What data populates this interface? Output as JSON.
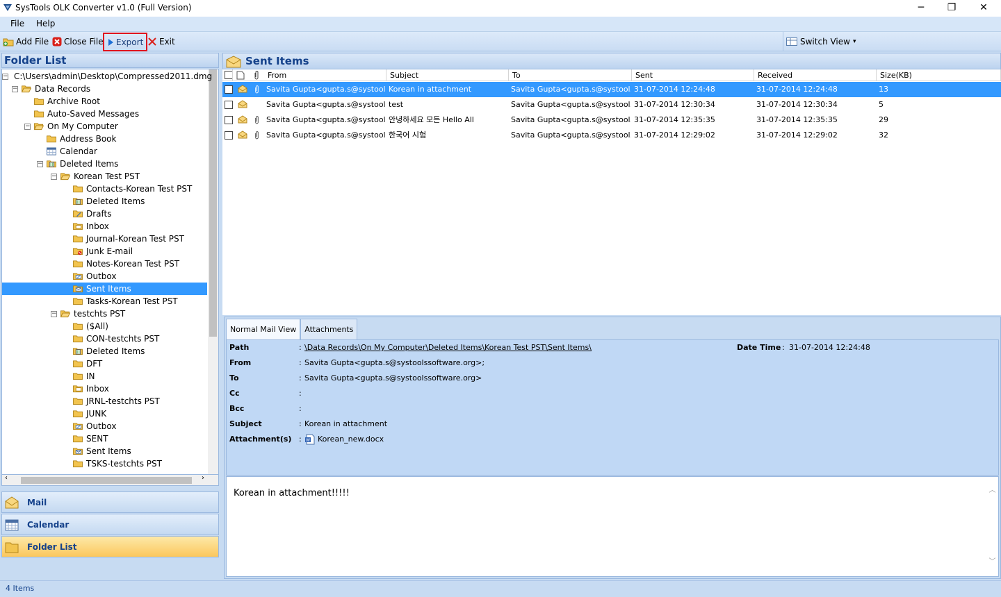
{
  "window": {
    "title": "SysTools OLK Converter v1.0 (Full Version)",
    "minimize": "─",
    "maximize": "❐",
    "close": "✕"
  },
  "menu": {
    "file": "File",
    "help": "Help"
  },
  "toolbar": {
    "add_file": "Add File",
    "close_file": "Close File",
    "export": "Export",
    "exit": "Exit",
    "switch_view": "Switch View",
    "switch_view_arrow": "▾"
  },
  "folder_panel": {
    "title": "Folder List",
    "tree": [
      {
        "label": "C:\\Users\\admin\\Desktop\\Compressed2011.dmg",
        "indent": 0,
        "expander": "−",
        "icon": "folder-open"
      },
      {
        "label": "Data Records",
        "indent": 1,
        "expander": "−",
        "icon": "folder-open"
      },
      {
        "label": "Archive Root",
        "indent": 2,
        "expander": "",
        "icon": "folder"
      },
      {
        "label": "Auto-Saved Messages",
        "indent": 2,
        "expander": "",
        "icon": "folder"
      },
      {
        "label": "On My Computer",
        "indent": 2,
        "expander": "−",
        "icon": "folder-open"
      },
      {
        "label": "Address Book",
        "indent": 3,
        "expander": "",
        "icon": "folder"
      },
      {
        "label": "Calendar",
        "indent": 3,
        "expander": "",
        "icon": "calendar"
      },
      {
        "label": "Deleted Items",
        "indent": 3,
        "expander": "−",
        "icon": "deleted"
      },
      {
        "label": "Korean Test PST",
        "indent": 4,
        "expander": "−",
        "icon": "folder-open"
      },
      {
        "label": "Contacts-Korean Test PST",
        "indent": 5,
        "expander": "",
        "icon": "folder"
      },
      {
        "label": "Deleted Items",
        "indent": 5,
        "expander": "",
        "icon": "deleted"
      },
      {
        "label": "Drafts",
        "indent": 5,
        "expander": "",
        "icon": "drafts"
      },
      {
        "label": "Inbox",
        "indent": 5,
        "expander": "",
        "icon": "inbox"
      },
      {
        "label": "Journal-Korean Test PST",
        "indent": 5,
        "expander": "",
        "icon": "folder"
      },
      {
        "label": "Junk E-mail",
        "indent": 5,
        "expander": "",
        "icon": "junk"
      },
      {
        "label": "Notes-Korean Test PST",
        "indent": 5,
        "expander": "",
        "icon": "folder"
      },
      {
        "label": "Outbox",
        "indent": 5,
        "expander": "",
        "icon": "outbox"
      },
      {
        "label": "Sent Items",
        "indent": 5,
        "expander": "",
        "icon": "sent",
        "selected": true
      },
      {
        "label": "Tasks-Korean Test PST",
        "indent": 5,
        "expander": "",
        "icon": "folder"
      },
      {
        "label": "testchts PST",
        "indent": 4,
        "expander": "−",
        "icon": "folder-open"
      },
      {
        "label": "($All)",
        "indent": 5,
        "expander": "",
        "icon": "folder"
      },
      {
        "label": "CON-testchts PST",
        "indent": 5,
        "expander": "",
        "icon": "folder"
      },
      {
        "label": "Deleted Items",
        "indent": 5,
        "expander": "",
        "icon": "deleted"
      },
      {
        "label": "DFT",
        "indent": 5,
        "expander": "",
        "icon": "folder"
      },
      {
        "label": "IN",
        "indent": 5,
        "expander": "",
        "icon": "folder"
      },
      {
        "label": "Inbox",
        "indent": 5,
        "expander": "",
        "icon": "inbox"
      },
      {
        "label": "JRNL-testchts PST",
        "indent": 5,
        "expander": "",
        "icon": "folder"
      },
      {
        "label": "JUNK",
        "indent": 5,
        "expander": "",
        "icon": "folder"
      },
      {
        "label": "Outbox",
        "indent": 5,
        "expander": "",
        "icon": "outbox"
      },
      {
        "label": "SENT",
        "indent": 5,
        "expander": "",
        "icon": "folder"
      },
      {
        "label": "Sent Items",
        "indent": 5,
        "expander": "",
        "icon": "sent"
      },
      {
        "label": "TSKS-testchts PST",
        "indent": 5,
        "expander": "",
        "icon": "folder"
      }
    ]
  },
  "nav": {
    "mail": "Mail",
    "calendar": "Calendar",
    "folder_list": "Folder List"
  },
  "list": {
    "title": "Sent Items",
    "columns": [
      "From",
      "Subject",
      "To",
      "Sent",
      "Received",
      "Size(KB)"
    ],
    "rows": [
      {
        "from": "Savita Gupta<gupta.s@systool...",
        "subject": "Korean in attachment",
        "to": "Savita Gupta<gupta.s@systool...",
        "sent": "31-07-2014 12:24:48",
        "received": "31-07-2014 12:24:48",
        "size": "13",
        "attachment": true,
        "selected": true
      },
      {
        "from": "Savita Gupta<gupta.s@systool...",
        "subject": "test",
        "to": "Savita Gupta<gupta.s@systool...",
        "sent": "31-07-2014 12:30:34",
        "received": "31-07-2014 12:30:34",
        "size": "5",
        "attachment": false
      },
      {
        "from": "Savita Gupta<gupta.s@systool...",
        "subject": "안녕하세요 모든 Hello  All",
        "to": "Savita Gupta<gupta.s@systool...",
        "sent": "31-07-2014 12:35:35",
        "received": "31-07-2014 12:35:35",
        "size": "29",
        "attachment": true
      },
      {
        "from": "Savita Gupta<gupta.s@systool...",
        "subject": "한국어 시험",
        "to": "Savita Gupta<gupta.s@systool...",
        "sent": "31-07-2014 12:29:02",
        "received": "31-07-2014 12:29:02",
        "size": "32",
        "attachment": true
      }
    ]
  },
  "detail": {
    "tabs": [
      "Normal Mail View",
      "Attachments"
    ],
    "path_label": "Path",
    "path_value": "\\Data Records\\On My Computer\\Deleted Items\\Korean Test PST\\Sent Items\\",
    "datetime_label": "Date Time",
    "datetime_value": "31-07-2014 12:24:48",
    "from_label": "From",
    "from_value": "Savita Gupta<gupta.s@systoolssoftware.org>;",
    "to_label": "To",
    "to_value": "Savita Gupta<gupta.s@systoolssoftware.org>",
    "cc_label": "Cc",
    "cc_value": "",
    "bcc_label": "Bcc",
    "bcc_value": "",
    "subject_label": "Subject",
    "subject_value": "Korean in attachment",
    "attachments_label": "Attachment(s)",
    "attachment_name": "Korean_new.docx",
    "colon": ":",
    "body": "Korean in attachment!!!!!"
  },
  "status": {
    "items": "4 Items"
  },
  "colors": {
    "accent": "#3399ff",
    "header_text": "#15428b",
    "highlight": "#e0141e"
  }
}
